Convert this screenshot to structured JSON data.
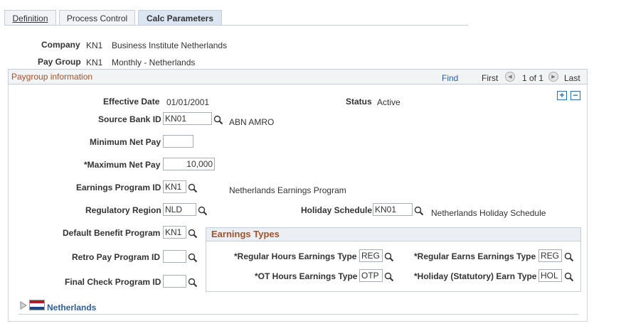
{
  "tabs": [
    {
      "label": "Definition",
      "active": false
    },
    {
      "label": "Process Control",
      "active": false
    },
    {
      "label": "Calc Parameters",
      "active": true
    }
  ],
  "header": {
    "company_label": "Company",
    "company_code": "KN1",
    "company_name": "Business Institute Netherlands",
    "paygroup_label": "Pay Group",
    "paygroup_code": "KN1",
    "paygroup_name": "Monthly - Netherlands"
  },
  "group": {
    "title": "Paygroup information",
    "find": "Find",
    "first": "First",
    "count": "1 of 1",
    "last": "Last",
    "add_icon": "plus-icon",
    "delete_icon": "minus-icon"
  },
  "fields": {
    "effective_date_label": "Effective Date",
    "effective_date": "01/01/2001",
    "status_label": "Status",
    "status": "Active",
    "source_bank_label": "Source Bank ID",
    "source_bank": "KN01",
    "source_bank_desc": "ABN AMRO",
    "min_net_pay_label": "Minimum Net Pay",
    "min_net_pay": "",
    "max_net_pay_label": "*Maximum Net Pay",
    "max_net_pay": "10,000",
    "earnings_program_label": "Earnings Program ID",
    "earnings_program": "KN1",
    "earnings_program_desc": "Netherlands Earnings Program",
    "regulatory_region_label": "Regulatory Region",
    "regulatory_region": "NLD",
    "holiday_schedule_label": "Holiday Schedule",
    "holiday_schedule": "KN01",
    "holiday_schedule_desc": "Netherlands Holiday Schedule",
    "default_benefit_label": "Default Benefit Program",
    "default_benefit": "KN1",
    "retro_pay_label": "Retro Pay Program ID",
    "retro_pay": "",
    "final_check_label": "Final Check Program ID",
    "final_check": ""
  },
  "earnings_types": {
    "title": "Earnings Types",
    "regular_hours_label": "*Regular Hours Earnings Type",
    "regular_hours": "REG",
    "regular_earns_label": "*Regular Earns Earnings Type",
    "regular_earns": "REG",
    "ot_hours_label": "*OT Hours Earnings Type",
    "ot_hours": "OTP",
    "holiday_earn_label": "*Holiday (Statutory) Earn Type",
    "holiday_earn": "HOL"
  },
  "footer": {
    "country_link": "Netherlands",
    "flag_colors": [
      "#ae1c28",
      "#ffffff",
      "#21468b"
    ]
  },
  "colors": {
    "link": "#2c5e9e",
    "group_title": "#a0522d",
    "border": "#c5cdd8"
  }
}
